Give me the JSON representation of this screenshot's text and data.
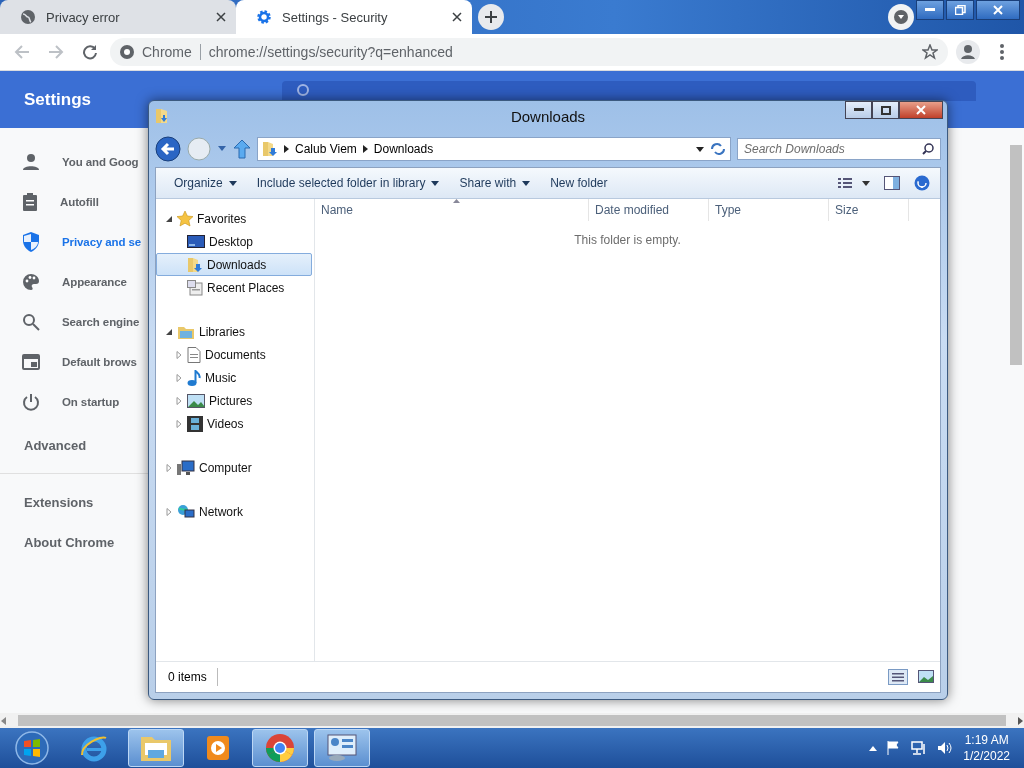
{
  "browser": {
    "tabs": [
      {
        "title": "Privacy error",
        "selected": false
      },
      {
        "title": "Settings - Security",
        "selected": true
      }
    ],
    "address": {
      "site_label": "Chrome",
      "url": "chrome://settings/security?q=enhanced"
    },
    "settings": {
      "title": "Settings",
      "nav": [
        {
          "label": "You and Goog",
          "selected": false
        },
        {
          "label": "Autofill",
          "selected": false
        },
        {
          "label": "Privacy and se",
          "selected": true
        },
        {
          "label": "Appearance",
          "selected": false
        },
        {
          "label": "Search engine",
          "selected": false
        },
        {
          "label": "Default brows",
          "selected": false
        },
        {
          "label": "On startup",
          "selected": false
        }
      ],
      "advanced": "Advanced",
      "links": [
        "Extensions",
        "About Chrome"
      ]
    }
  },
  "explorer": {
    "title": "Downloads",
    "breadcrumb": [
      "Calub Viem",
      "Downloads"
    ],
    "search": {
      "placeholder": "Search Downloads"
    },
    "toolbar": [
      {
        "label": "Organize",
        "dropdown": true
      },
      {
        "label": "Include selected folder in library",
        "dropdown": true
      },
      {
        "label": "Share with",
        "dropdown": true
      },
      {
        "label": "New folder",
        "dropdown": false
      }
    ],
    "tree": [
      {
        "label": "Favorites",
        "expanded": true,
        "selected": false,
        "children": [
          {
            "label": "Desktop",
            "selected": false
          },
          {
            "label": "Downloads",
            "selected": true
          },
          {
            "label": "Recent Places",
            "selected": false
          }
        ]
      },
      {
        "label": "Libraries",
        "expanded": true,
        "selected": false,
        "children": [
          {
            "label": "Documents",
            "selected": false,
            "expanded": false
          },
          {
            "label": "Music",
            "selected": false,
            "expanded": false
          },
          {
            "label": "Pictures",
            "selected": false,
            "expanded": false
          },
          {
            "label": "Videos",
            "selected": false,
            "expanded": false
          }
        ]
      },
      {
        "label": "Computer",
        "expanded": false,
        "selected": false
      },
      {
        "label": "Network",
        "expanded": false,
        "selected": false
      }
    ],
    "columns": [
      "Name",
      "Date modified",
      "Type",
      "Size"
    ],
    "empty_message": "This folder is empty.",
    "status": "0 items"
  },
  "taskbar": {
    "apps": [
      {
        "kind": "ie",
        "open": false
      },
      {
        "kind": "explorer",
        "open": true
      },
      {
        "kind": "media",
        "open": false
      },
      {
        "kind": "chrome",
        "open": true
      },
      {
        "kind": "control",
        "open": true
      }
    ],
    "time": "1:19 AM",
    "date": "1/2/2022"
  }
}
